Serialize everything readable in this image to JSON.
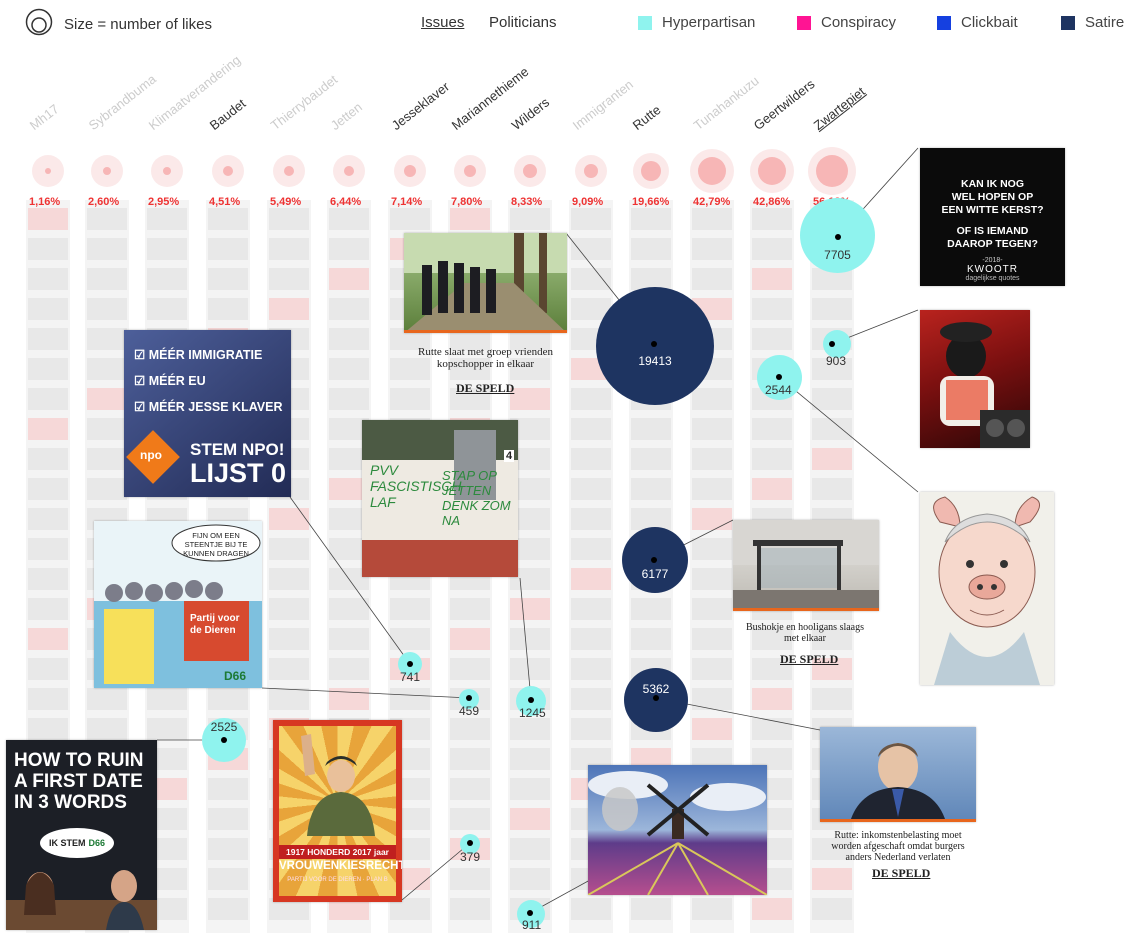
{
  "legend": {
    "size_label": "Size = number of likes"
  },
  "nav": {
    "issues": "Issues",
    "politicians": "Politicians"
  },
  "categories": [
    {
      "label": "Hyperpartisan",
      "color": "#8ff3ee"
    },
    {
      "label": "Conspiracy",
      "color": "#ff1493"
    },
    {
      "label": "Clickbait",
      "color": "#1540e0"
    },
    {
      "label": "Satire",
      "color": "#1e3461"
    }
  ],
  "topics": [
    {
      "label": "Mh17",
      "pct": "1,16%"
    },
    {
      "label": "Sybrandbuma",
      "pct": "2,60%"
    },
    {
      "label": "Klimaatverandering",
      "pct": "2,95%"
    },
    {
      "label": "Baudet",
      "pct": "4,51%"
    },
    {
      "label": "Thierrybaudet",
      "pct": "5,49%"
    },
    {
      "label": "Jetten",
      "pct": "6,44%"
    },
    {
      "label": "Jesseklaver",
      "pct": "7,14%"
    },
    {
      "label": "Mariannethieme",
      "pct": "7,80%"
    },
    {
      "label": "Wilders",
      "pct": "8,33%"
    },
    {
      "label": "Immigranten",
      "pct": "9,09%"
    },
    {
      "label": "Rutte",
      "pct": "19,66%"
    },
    {
      "label": "Tunahankuzu",
      "pct": "42,79%"
    },
    {
      "label": "Geertwilders",
      "pct": "42,86%"
    },
    {
      "label": "Zwartepiet",
      "pct": "56,12%"
    }
  ],
  "bubbles": {
    "b7705": "7705",
    "b903": "903",
    "b2544": "2544",
    "b19413": "19413",
    "b6177": "6177",
    "b5362": "5362",
    "b741": "741",
    "b459": "459",
    "b1245": "1245",
    "b2525": "2525",
    "b379": "379",
    "b911": "911"
  },
  "cards": {
    "kwootr": {
      "line1": "KAN IK NOG",
      "line2": "WEL HOPEN OP",
      "line3": "EEN WITTE KERST?",
      "line4": "OF IS IEMAND",
      "line5": "DAAROP TEGEN?",
      "year": "-2018-",
      "brand": "KWOOTR",
      "sub": "dagelijkse quotes"
    },
    "npo": {
      "item1": "MÉÉR IMMIGRATIE",
      "item2": "MÉÉR EU",
      "item3": "MÉÉR JESSE KLAVER",
      "logo": "npo",
      "title1": "STEM NPO!",
      "title2": "LIJST 0"
    },
    "rutte_speld": {
      "caption": "Rutte slaat met groep vrienden kopschopper in elkaar",
      "brand": "DE SPELD"
    },
    "bushokje_speld": {
      "caption": "Bushokje en hooligans slaags met elkaar",
      "brand": "DE SPELD"
    },
    "rutte_tax": {
      "caption": "Rutte: inkomstenbelasting moet worden afgeschaft omdat burgers anders Nederland verlaten",
      "brand": "DE SPELD"
    },
    "graffiti": {
      "text1": "PVV FASCISTISCH LAF",
      "text2": "STAP OP JETTEN DENK ZOM NA",
      "num": "4"
    },
    "cartoon": {
      "bubble": "FIJN OM EEN STEENTJE BIJ TE KUNNEN DRAGEN",
      "sign": "Partij voor de Dieren",
      "tag": "D66"
    },
    "firstdate": {
      "title": "HOW TO RUIN A FIRST DATE IN 3 WORDS",
      "bubble_a": "IK STEM",
      "bubble_b": "D66"
    },
    "vrouwen": {
      "banner": "1917 HONDERD 2017 jaar",
      "title": "VROUWENKIESRECHT",
      "sub": "PARTIJ VOOR DE DIEREN · PLAN B"
    }
  }
}
